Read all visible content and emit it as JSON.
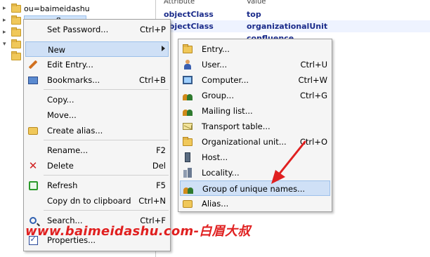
{
  "tree": {
    "rows": [
      {
        "label": "ou=baimeidashu"
      },
      {
        "label": "ou=confluence"
      },
      {
        "label": ""
      },
      {
        "label": ""
      },
      {
        "label": ""
      }
    ]
  },
  "attributes": {
    "header_attr": "Attribute",
    "header_value": "Value",
    "rows": [
      {
        "attr": "objectClass",
        "value": "top"
      },
      {
        "attr": "objectClass",
        "value": "organizationalUnit"
      },
      {
        "attr": "",
        "value": "confluence"
      }
    ]
  },
  "context_menu": {
    "items": [
      {
        "label": "Set Password...",
        "shortcut": "Ctrl+P",
        "icon": "none"
      },
      {
        "label": "New",
        "shortcut": "",
        "icon": "none"
      },
      {
        "label": "Edit Entry...",
        "shortcut": "",
        "icon": "pencil-icon"
      },
      {
        "label": "Bookmarks...",
        "shortcut": "Ctrl+B",
        "icon": "bookmark-icon"
      },
      {
        "label": "Copy...",
        "shortcut": "",
        "icon": "none"
      },
      {
        "label": "Move...",
        "shortcut": "",
        "icon": "none"
      },
      {
        "label": "Create alias...",
        "shortcut": "",
        "icon": "alias-icon"
      },
      {
        "label": "Rename...",
        "shortcut": "F2",
        "icon": "none"
      },
      {
        "label": "Delete",
        "shortcut": "Del",
        "icon": "delete-icon"
      },
      {
        "label": "Refresh",
        "shortcut": "F5",
        "icon": "refresh-icon"
      },
      {
        "label": "Copy dn to clipboard",
        "shortcut": "Ctrl+N",
        "icon": "none"
      },
      {
        "label": "Search...",
        "shortcut": "Ctrl+F",
        "icon": "search-icon"
      },
      {
        "label": "Properties...",
        "shortcut": "",
        "icon": "properties-icon"
      }
    ]
  },
  "new_submenu": {
    "items": [
      {
        "label": "Entry...",
        "shortcut": "",
        "icon": "folder-icon"
      },
      {
        "label": "User...",
        "shortcut": "Ctrl+U",
        "icon": "user-icon"
      },
      {
        "label": "Computer...",
        "shortcut": "Ctrl+W",
        "icon": "computer-icon"
      },
      {
        "label": "Group...",
        "shortcut": "Ctrl+G",
        "icon": "group-icon"
      },
      {
        "label": "Mailing list...",
        "shortcut": "",
        "icon": "mailing-list-icon"
      },
      {
        "label": "Transport table...",
        "shortcut": "",
        "icon": "mail-icon"
      },
      {
        "label": "Organizational unit...",
        "shortcut": "Ctrl+O",
        "icon": "folder-icon"
      },
      {
        "label": "Host...",
        "shortcut": "",
        "icon": "host-icon"
      },
      {
        "label": "Locality...",
        "shortcut": "",
        "icon": "locality-icon"
      },
      {
        "label": "Group of unique names...",
        "shortcut": "",
        "icon": "group-icon"
      },
      {
        "label": "Alias...",
        "shortcut": "",
        "icon": "alias-icon"
      }
    ],
    "highlighted_label": "Group of unique names..."
  },
  "watermark": {
    "text": "www.baimeidashu.com-白眉大叔"
  },
  "colors": {
    "menu_bg": "#f5f5f5",
    "highlight": "#cfe0f6",
    "attr_text": "#1a2b8a",
    "annotation_red": "#e02020"
  }
}
